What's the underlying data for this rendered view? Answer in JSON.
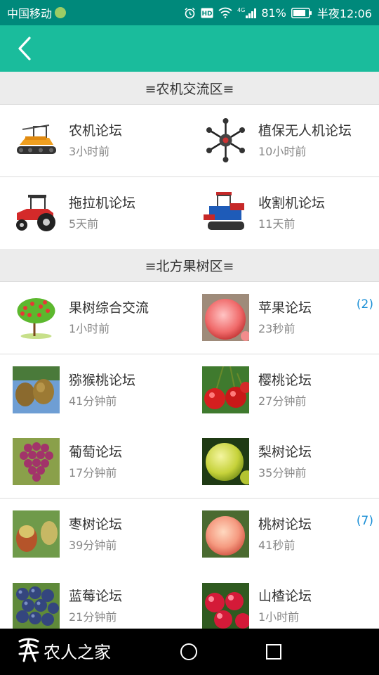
{
  "status_bar": {
    "carrier": "中国移动",
    "signal_type": "4G",
    "battery": "81%",
    "time": "半夜12:06"
  },
  "colors": {
    "status_bar": "#00897b",
    "app_bar": "#1abc9c",
    "badge": "#1a8fd6",
    "section_bg": "#ececec"
  },
  "sections": [
    {
      "header": "≡农机交流区≡",
      "forums": [
        {
          "title": "农机论坛",
          "time": "3小时前",
          "badge": "",
          "icon": "orange-crawler-machine"
        },
        {
          "title": "植保无人机论坛",
          "time": "10小时前",
          "badge": "",
          "icon": "agricultural-drone"
        },
        {
          "title": "拖拉机论坛",
          "time": "5天前",
          "badge": "",
          "icon": "red-tractor"
        },
        {
          "title": "收割机论坛",
          "time": "11天前",
          "badge": "",
          "icon": "blue-harvester"
        }
      ]
    },
    {
      "header": "≡北方果树区≡",
      "forums": [
        {
          "title": "果树综合交流",
          "time": "1小时前",
          "badge": "",
          "icon": "fruit-tree"
        },
        {
          "title": "苹果论坛",
          "time": "23秒前",
          "badge": "(2)",
          "icon": "apple-photo"
        },
        {
          "title": "猕猴桃论坛",
          "time": "41分钟前",
          "badge": "",
          "icon": "kiwi-photo"
        },
        {
          "title": "樱桃论坛",
          "time": "27分钟前",
          "badge": "",
          "icon": "cherry-photo"
        },
        {
          "title": "葡萄论坛",
          "time": "17分钟前",
          "badge": "",
          "icon": "grape-photo"
        },
        {
          "title": "梨树论坛",
          "time": "35分钟前",
          "badge": "",
          "icon": "pear-photo"
        },
        {
          "title": "枣树论坛",
          "time": "39分钟前",
          "badge": "",
          "icon": "jujube-photo"
        },
        {
          "title": "桃树论坛",
          "time": "41秒前",
          "badge": "(7)",
          "icon": "peach-photo"
        },
        {
          "title": "蓝莓论坛",
          "time": "21分钟前",
          "badge": "",
          "icon": "blueberry-photo"
        },
        {
          "title": "山楂论坛",
          "time": "1小时前",
          "badge": "",
          "icon": "hawthorn-photo"
        }
      ]
    }
  ],
  "nav_bar": {
    "brand": "农人之家"
  }
}
